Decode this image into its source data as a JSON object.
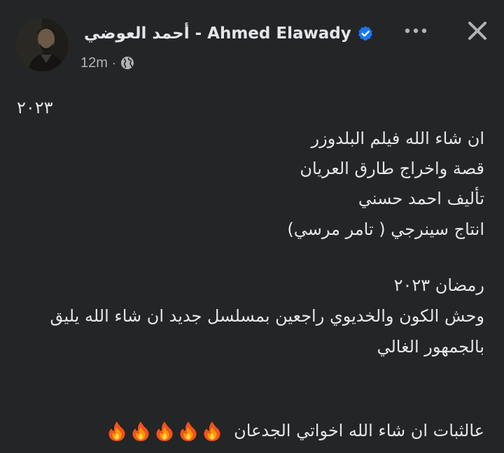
{
  "post": {
    "author": "أحمد العوضي - Ahmed Elawady",
    "time": "12m",
    "separator": "·",
    "verified_icon": "verified-badge-icon",
    "privacy_icon": "globe-icon",
    "more_icon": "more-dots-icon",
    "close_icon": "close-icon"
  },
  "content": {
    "year_line": "٢٠٢٣",
    "lines": [
      "ان شاء الله فيلم البلدوزر",
      "قصة واخراج طارق العريان",
      "تأليف احمد حسني",
      "انتاج سينرجي ( تامر مرسي)",
      "رمضان ٢٠٢٣",
      "وحش الكون والخديوي راجعين بمسلسل جديد ان شاء الله يليق",
      "بالجمهور الغالي",
      "عالثبات ان شاء الله اخواتي الجدعان"
    ],
    "fire_icon": "fire-emoji-icon",
    "fire_count": 5
  },
  "colors": {
    "background": "#242526",
    "text": "#e4e6eb",
    "secondary": "#b0b3b8",
    "verified": "#1877f2"
  }
}
